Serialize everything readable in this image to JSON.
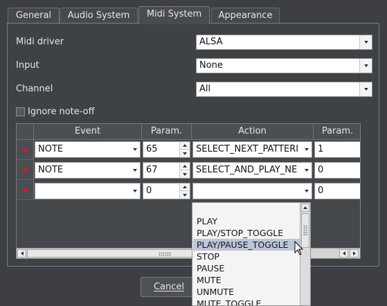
{
  "tabs": [
    {
      "label": "General"
    },
    {
      "label": "Audio System"
    },
    {
      "label": "Midi System"
    },
    {
      "label": "Appearance"
    }
  ],
  "settings": {
    "midi_driver": {
      "label": "Midi driver",
      "value": "ALSA"
    },
    "input": {
      "label": "Input",
      "value": "None"
    },
    "channel": {
      "label": "Channel",
      "value": "All"
    },
    "ignore_note_off": {
      "label": "Ignore note-off",
      "checked": false
    }
  },
  "table": {
    "columns": [
      "Event",
      "Param.",
      "Action",
      "Param."
    ],
    "rows": [
      {
        "event": "NOTE",
        "param": "65",
        "action": "SELECT_NEXT_PATTERI",
        "action_param": "1"
      },
      {
        "event": "NOTE",
        "param": "67",
        "action": "SELECT_AND_PLAY_NE",
        "action_param": "0"
      },
      {
        "event": "",
        "param": "0",
        "action": "",
        "action_param": "0"
      }
    ]
  },
  "dropdown": {
    "items": [
      "PLAY",
      "PLAY/STOP_TOGGLE",
      "PLAY/PAUSE_TOGGLE",
      "STOP",
      "PAUSE",
      "MUTE",
      "UNMUTE",
      "MUTE_TOGGLE"
    ],
    "highlighted": "PLAY/PAUSE_TOGGLE"
  },
  "buttons": {
    "cancel": "Cancel"
  },
  "colors": {
    "background": "#3d3f42",
    "row_indicator": "#e0161c",
    "highlight": "#bcc6d6"
  }
}
